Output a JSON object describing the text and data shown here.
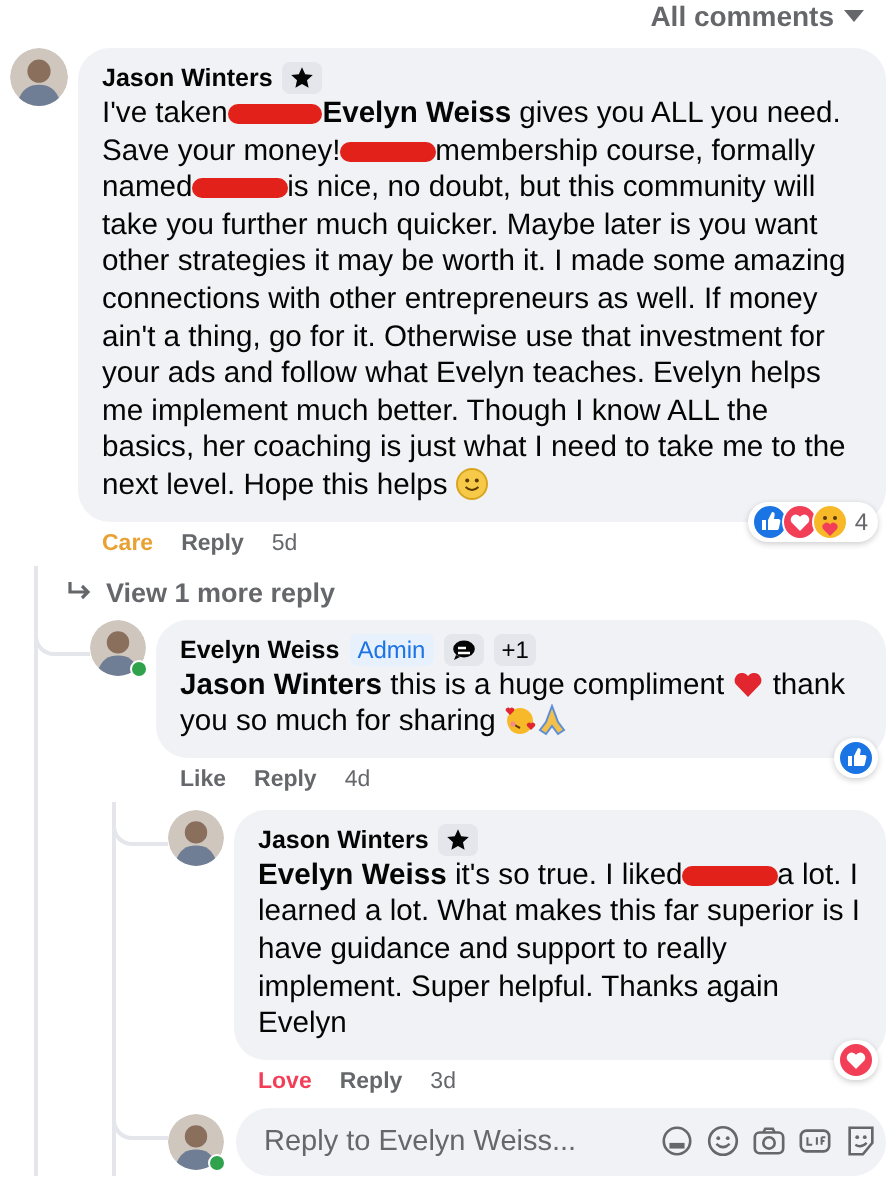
{
  "header": {
    "filter": "All comments"
  },
  "comments": [
    {
      "author": "Jason Winters",
      "online": false,
      "badges": [
        {
          "kind": "star"
        }
      ],
      "body": [
        {
          "kind": "text",
          "text": "I've taken"
        },
        {
          "kind": "redaction"
        },
        {
          "kind": "mention",
          "text": "Evelyn Weiss"
        },
        {
          "kind": "text",
          "text": " gives you ALL you need. Save your money!"
        },
        {
          "kind": "redaction"
        },
        {
          "kind": "text",
          "text": "membership course, formally named"
        },
        {
          "kind": "redaction"
        },
        {
          "kind": "text",
          "text": "is nice, no doubt, but this community will take you further much quicker. Maybe later is you want other strategies it may be worth it. I made some amazing connections with other entrepreneurs as well. If money ain't a thing, go for it. Otherwise use that investment for your ads and follow what Evelyn teaches. Evelyn helps me implement much better. Though I know ALL the basics, her coaching is just what I need to take me to the next level. Hope this helps "
        },
        {
          "kind": "smile"
        }
      ],
      "actions": [
        {
          "kind": "care",
          "label": "Care"
        },
        {
          "kind": "reply",
          "label": "Reply"
        },
        {
          "kind": "time",
          "label": "5d"
        }
      ],
      "reactions": [
        {
          "kind": "like"
        },
        {
          "kind": "love"
        },
        {
          "kind": "care"
        }
      ],
      "reaction_count": "4",
      "view_more": "View 1 more reply",
      "children": [
        {
          "author": "Evelyn Weiss",
          "online": true,
          "badges": [
            {
              "kind": "admin",
              "label": "Admin"
            },
            {
              "kind": "chat"
            },
            {
              "kind": "more",
              "label": "+1"
            }
          ],
          "body": [
            {
              "kind": "mention",
              "text": "Jason Winters"
            },
            {
              "kind": "text",
              "text": " this is a huge compliment "
            },
            {
              "kind": "heart"
            },
            {
              "kind": "text",
              "text": " thank you so much for sharing "
            },
            {
              "kind": "hearts"
            },
            {
              "kind": "pray"
            }
          ],
          "actions": [
            {
              "kind": "like",
              "label": "Like"
            },
            {
              "kind": "reply",
              "label": "Reply"
            },
            {
              "kind": "time",
              "label": "4d"
            }
          ],
          "reactions": [
            {
              "kind": "like"
            }
          ],
          "children": [
            {
              "author": "Jason Winters",
              "online": false,
              "badges": [
                {
                  "kind": "star"
                }
              ],
              "body": [
                {
                  "kind": "mention",
                  "text": "Evelyn Weiss"
                },
                {
                  "kind": "text",
                  "text": " it's so true. I liked"
                },
                {
                  "kind": "redaction"
                },
                {
                  "kind": "text",
                  "text": "a lot. I learned a lot. What makes this far superior is I have guidance and support to really implement. Super helpful. Thanks again Evelyn"
                }
              ],
              "actions": [
                {
                  "kind": "love",
                  "label": "Love"
                },
                {
                  "kind": "reply",
                  "label": "Reply"
                },
                {
                  "kind": "time",
                  "label": "3d"
                }
              ],
              "reactions": [
                {
                  "kind": "love"
                }
              ]
            }
          ],
          "reply_field": {
            "placeholder": "Reply to Evelyn Weiss...",
            "online": true
          }
        }
      ]
    }
  ]
}
